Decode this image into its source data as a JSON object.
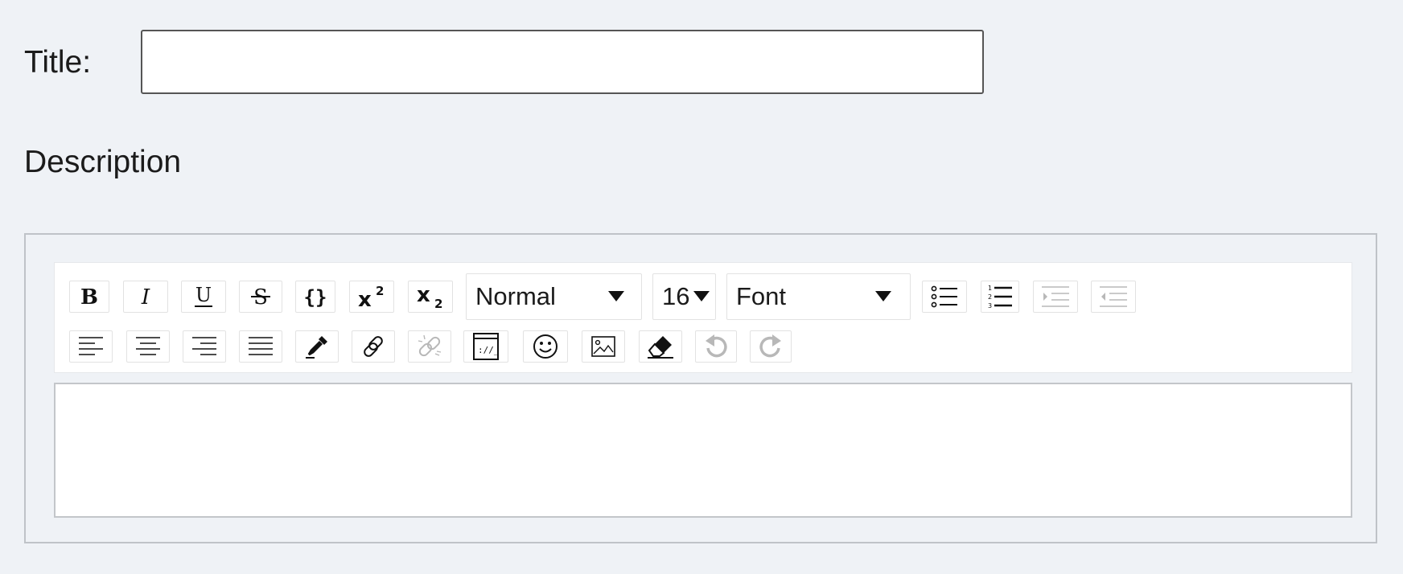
{
  "form": {
    "title_label": "Title:",
    "title_value": "",
    "description_label": "Description"
  },
  "toolbar": {
    "row1": [
      {
        "name": "bold-button",
        "icon": "bold-icon"
      },
      {
        "name": "italic-button",
        "icon": "italic-icon"
      },
      {
        "name": "underline-button",
        "icon": "underline-icon"
      },
      {
        "name": "strikethrough-button",
        "icon": "strikethrough-icon"
      },
      {
        "name": "code-button",
        "icon": "braces-icon"
      },
      {
        "name": "superscript-button",
        "icon": "superscript-icon"
      },
      {
        "name": "subscript-button",
        "icon": "subscript-icon"
      }
    ],
    "block_type": {
      "selected": "Normal"
    },
    "font_size": {
      "selected": "16"
    },
    "font_family": {
      "selected": "Font"
    },
    "list_buttons": [
      {
        "name": "unordered-list-button",
        "icon": "bulleted-list-icon",
        "enabled": true
      },
      {
        "name": "ordered-list-button",
        "icon": "numbered-list-icon",
        "enabled": true
      },
      {
        "name": "indent-button",
        "icon": "indent-icon",
        "enabled": false
      },
      {
        "name": "outdent-button",
        "icon": "outdent-icon",
        "enabled": false
      }
    ],
    "row2": [
      {
        "name": "align-left-button",
        "icon": "align-left-icon",
        "enabled": true
      },
      {
        "name": "align-center-button",
        "icon": "align-center-icon",
        "enabled": true
      },
      {
        "name": "align-right-button",
        "icon": "align-right-icon",
        "enabled": true
      },
      {
        "name": "align-justify-button",
        "icon": "align-justify-icon",
        "enabled": true
      },
      {
        "name": "color-picker-button",
        "icon": "eyedropper-icon",
        "enabled": true
      },
      {
        "name": "link-button",
        "icon": "link-icon",
        "enabled": true
      },
      {
        "name": "unlink-button",
        "icon": "unlink-icon",
        "enabled": false
      },
      {
        "name": "embed-button",
        "icon": "embed-icon",
        "enabled": true
      },
      {
        "name": "emoji-button",
        "icon": "smiley-icon",
        "enabled": true
      },
      {
        "name": "image-button",
        "icon": "image-icon",
        "enabled": true
      },
      {
        "name": "remove-format-button",
        "icon": "eraser-icon",
        "enabled": true
      },
      {
        "name": "undo-button",
        "icon": "undo-icon",
        "enabled": false
      },
      {
        "name": "redo-button",
        "icon": "redo-icon",
        "enabled": false
      }
    ]
  },
  "editor": {
    "content": ""
  },
  "colors": {
    "page_background": "#eff2f6",
    "disabled_icon": "#b8b8b8",
    "icon": "#111111"
  }
}
